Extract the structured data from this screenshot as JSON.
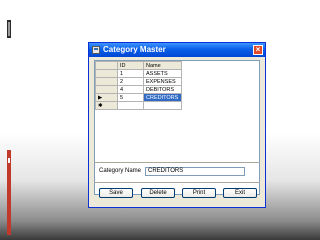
{
  "window": {
    "title": "Category Master",
    "close_glyph": "×"
  },
  "grid": {
    "columns": [
      "ID",
      "Name"
    ],
    "rows": [
      {
        "id": "1",
        "name": "ASSETS"
      },
      {
        "id": "2",
        "name": "EXPENSES"
      },
      {
        "id": "4",
        "name": "DEBITORS"
      },
      {
        "id": "5",
        "name": "CREDITORS"
      }
    ],
    "row_indicator_current": "▶",
    "row_indicator_new": "✱"
  },
  "form": {
    "category_name_label": "Category Name",
    "category_name_value": "CREDITORS"
  },
  "buttons": {
    "save": "Save",
    "delete": "Delete",
    "print": "Print",
    "exit": "Exit"
  },
  "colors": {
    "titlebar": "#0a5fe8",
    "selection": "#316ac5",
    "accent_bar": "#c0392b"
  }
}
